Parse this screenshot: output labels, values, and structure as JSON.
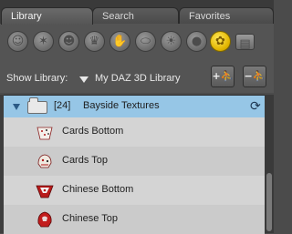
{
  "tabs": [
    {
      "label": "Library",
      "active": true
    },
    {
      "label": "Search",
      "active": false
    },
    {
      "label": "Favorites",
      "active": false
    }
  ],
  "toolbar": {
    "icons": [
      {
        "name": "figure-icon"
      },
      {
        "name": "pose-icon"
      },
      {
        "name": "face-icon"
      },
      {
        "name": "hair-icon"
      },
      {
        "name": "hand-icon"
      },
      {
        "name": "props-icon"
      },
      {
        "name": "light-icon"
      },
      {
        "name": "camera-icon"
      },
      {
        "name": "materials-icon",
        "selected": true
      },
      {
        "name": "scene-icon"
      }
    ],
    "accent_color": "#e2b500"
  },
  "show_library": {
    "label": "Show Library:",
    "value": "My DAZ 3D Library",
    "add_folder_label": "+",
    "remove_folder_label": "−"
  },
  "list": {
    "folder": {
      "count": "[24]",
      "name": "Bayside Textures",
      "highlight_color": "#96c6e6"
    },
    "items": [
      {
        "label": "Cards Bottom"
      },
      {
        "label": "Cards Top"
      },
      {
        "label": "Chinese Bottom"
      },
      {
        "label": "Chinese Top"
      }
    ]
  }
}
